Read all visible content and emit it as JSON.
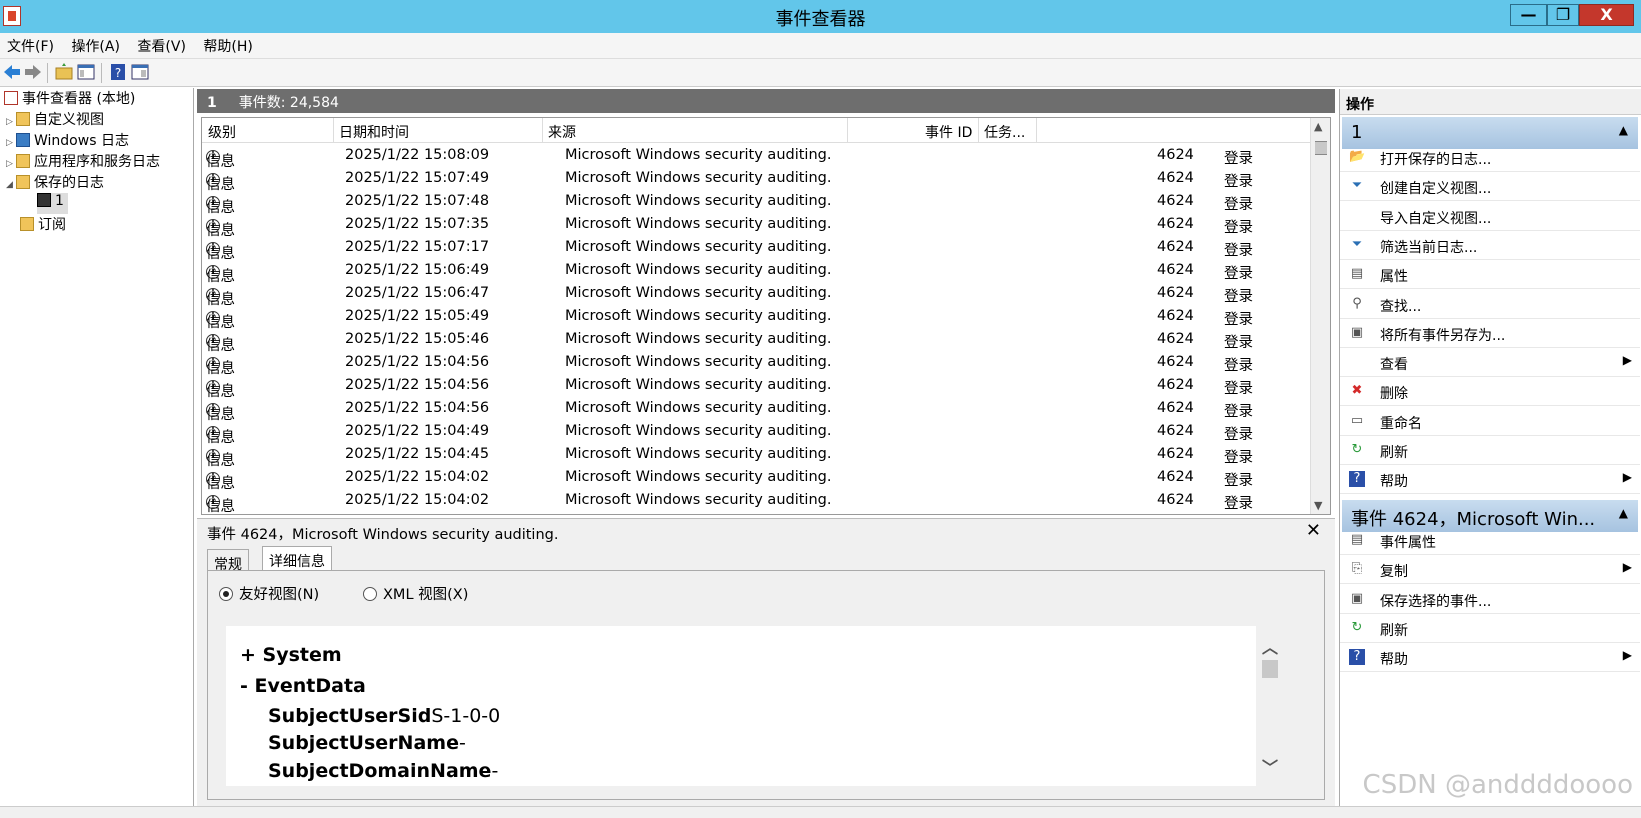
{
  "window": {
    "title": "事件查看器",
    "min": "—",
    "max": "❐",
    "close": "X"
  },
  "menu": [
    "文件(F)",
    "操作(A)",
    "查看(V)",
    "帮助(H)"
  ],
  "toolbar_icons": [
    "back-icon",
    "forward-icon",
    "up-folder-icon",
    "show-hide-tree-icon",
    "help-icon",
    "action-pane-icon"
  ],
  "tree": [
    {
      "label": "事件查看器 (本地)",
      "icon": "event-viewer-icon"
    },
    {
      "label": "自定义视图",
      "icon": "folder-icon"
    },
    {
      "label": "Windows 日志",
      "icon": "windows-log-icon"
    },
    {
      "label": "应用程序和服务日志",
      "icon": "folder-icon"
    },
    {
      "label": "保存的日志",
      "icon": "folder-icon"
    },
    {
      "label": "1",
      "icon": "floppy-icon"
    },
    {
      "label": "订阅",
      "icon": "folder-icon"
    }
  ],
  "center": {
    "log_name": "1",
    "count_label": "事件数: 24,584"
  },
  "grid": {
    "columns": [
      "级别",
      "日期和时间",
      "来源",
      "事件 ID",
      "任务..."
    ],
    "rows": [
      {
        "level": "信息",
        "date": "2025/1/22 15:08:09",
        "source": "Microsoft Windows security auditing.",
        "id": "4624",
        "task": "登录"
      },
      {
        "level": "信息",
        "date": "2025/1/22 15:07:49",
        "source": "Microsoft Windows security auditing.",
        "id": "4624",
        "task": "登录"
      },
      {
        "level": "信息",
        "date": "2025/1/22 15:07:48",
        "source": "Microsoft Windows security auditing.",
        "id": "4624",
        "task": "登录"
      },
      {
        "level": "信息",
        "date": "2025/1/22 15:07:35",
        "source": "Microsoft Windows security auditing.",
        "id": "4624",
        "task": "登录"
      },
      {
        "level": "信息",
        "date": "2025/1/22 15:07:17",
        "source": "Microsoft Windows security auditing.",
        "id": "4624",
        "task": "登录"
      },
      {
        "level": "信息",
        "date": "2025/1/22 15:06:49",
        "source": "Microsoft Windows security auditing.",
        "id": "4624",
        "task": "登录"
      },
      {
        "level": "信息",
        "date": "2025/1/22 15:06:47",
        "source": "Microsoft Windows security auditing.",
        "id": "4624",
        "task": "登录"
      },
      {
        "level": "信息",
        "date": "2025/1/22 15:05:49",
        "source": "Microsoft Windows security auditing.",
        "id": "4624",
        "task": "登录"
      },
      {
        "level": "信息",
        "date": "2025/1/22 15:05:46",
        "source": "Microsoft Windows security auditing.",
        "id": "4624",
        "task": "登录"
      },
      {
        "level": "信息",
        "date": "2025/1/22 15:04:56",
        "source": "Microsoft Windows security auditing.",
        "id": "4624",
        "task": "登录"
      },
      {
        "level": "信息",
        "date": "2025/1/22 15:04:56",
        "source": "Microsoft Windows security auditing.",
        "id": "4624",
        "task": "登录"
      },
      {
        "level": "信息",
        "date": "2025/1/22 15:04:56",
        "source": "Microsoft Windows security auditing.",
        "id": "4624",
        "task": "登录"
      },
      {
        "level": "信息",
        "date": "2025/1/22 15:04:49",
        "source": "Microsoft Windows security auditing.",
        "id": "4624",
        "task": "登录"
      },
      {
        "level": "信息",
        "date": "2025/1/22 15:04:45",
        "source": "Microsoft Windows security auditing.",
        "id": "4624",
        "task": "登录"
      },
      {
        "level": "信息",
        "date": "2025/1/22 15:04:02",
        "source": "Microsoft Windows security auditing.",
        "id": "4624",
        "task": "登录"
      },
      {
        "level": "信息",
        "date": "2025/1/22 15:04:02",
        "source": "Microsoft Windows security auditing.",
        "id": "4624",
        "task": "登录"
      }
    ]
  },
  "detail": {
    "title": "事件 4624，Microsoft Windows security auditing.",
    "close": "✕",
    "tabs": [
      "常规",
      "详细信息"
    ],
    "radio_friendly": "友好视图(N)",
    "radio_xml": "XML 视图(X)",
    "xml": {
      "system": "+ System",
      "eventdata": "-  EventData",
      "fields": [
        {
          "name": "SubjectUserSid",
          "value": "S-1-0-0"
        },
        {
          "name": "SubjectUserName",
          "value": "-"
        },
        {
          "name": "SubjectDomainName",
          "value": "-"
        }
      ]
    }
  },
  "actions": {
    "header": "操作",
    "group1": "1",
    "items1": [
      {
        "label": "打开保存的日志...",
        "icon": "open-log-icon",
        "more": false
      },
      {
        "label": "创建自定义视图...",
        "icon": "filter-icon",
        "more": false
      },
      {
        "label": "导入自定义视图...",
        "icon": "",
        "more": false
      },
      {
        "label": "筛选当前日志...",
        "icon": "filter-icon",
        "more": false
      },
      {
        "label": "属性",
        "icon": "properties-icon",
        "more": false
      },
      {
        "label": "查找...",
        "icon": "find-icon",
        "more": false
      },
      {
        "label": "将所有事件另存为...",
        "icon": "save-icon",
        "more": false
      },
      {
        "label": "查看",
        "icon": "",
        "more": true
      },
      {
        "label": "删除",
        "icon": "delete-icon",
        "more": false
      },
      {
        "label": "重命名",
        "icon": "rename-icon",
        "more": false
      },
      {
        "label": "刷新",
        "icon": "refresh-icon",
        "more": false
      },
      {
        "label": "帮助",
        "icon": "help-icon",
        "more": true
      }
    ],
    "group2": "事件 4624，Microsoft Win...",
    "items2": [
      {
        "label": "事件属性",
        "icon": "properties-icon",
        "more": false
      },
      {
        "label": "复制",
        "icon": "copy-icon",
        "more": true
      },
      {
        "label": "保存选择的事件...",
        "icon": "save-icon",
        "more": false
      },
      {
        "label": "刷新",
        "icon": "refresh-icon",
        "more": false
      },
      {
        "label": "帮助",
        "icon": "help-icon",
        "more": true
      }
    ]
  },
  "watermark": "CSDN @anddddoooo"
}
